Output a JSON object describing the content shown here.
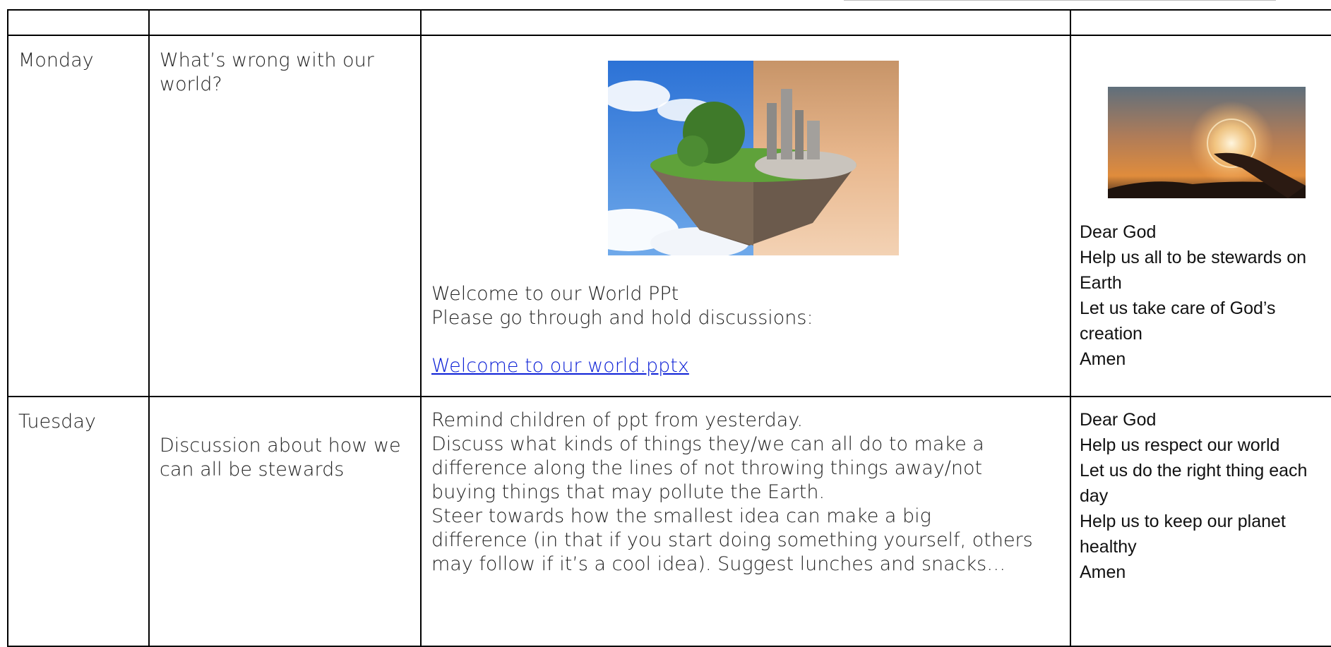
{
  "days": [
    {
      "day": "Monday",
      "topic": "What’s wrong with our world?",
      "activity": {
        "image": "floating-island-earth-image",
        "lines": [
          "Welcome to our World PPt",
          "Please go through and hold discussions:"
        ],
        "link": "Welcome to our world.pptx"
      },
      "prayer": {
        "image": "hands-sunset-image",
        "lines": [
          "Dear God",
          "Help us all to be stewards on",
          "Earth",
          "Let us take care of God’s",
          "creation",
          "Amen"
        ]
      }
    },
    {
      "day": "Tuesday",
      "topic": "Discussion about how we can all be stewards",
      "activity": {
        "lines": [
          "Remind children of ppt from yesterday.",
          "Discuss what kinds of things they/we can all do to make a",
          "difference along the lines of not throwing things away/not",
          "buying things that may pollute the Earth.",
          "Steer towards how the smallest idea can make a big",
          "difference (in that if you start doing something yourself, others",
          "may follow if it’s a cool idea).  Suggest lunches and snacks…"
        ]
      },
      "prayer": {
        "lines": [
          "Dear God",
          "Help us respect our world",
          "Let us do the right thing each",
          "day",
          "Help us to keep our planet",
          "healthy",
          "Amen"
        ]
      }
    }
  ]
}
